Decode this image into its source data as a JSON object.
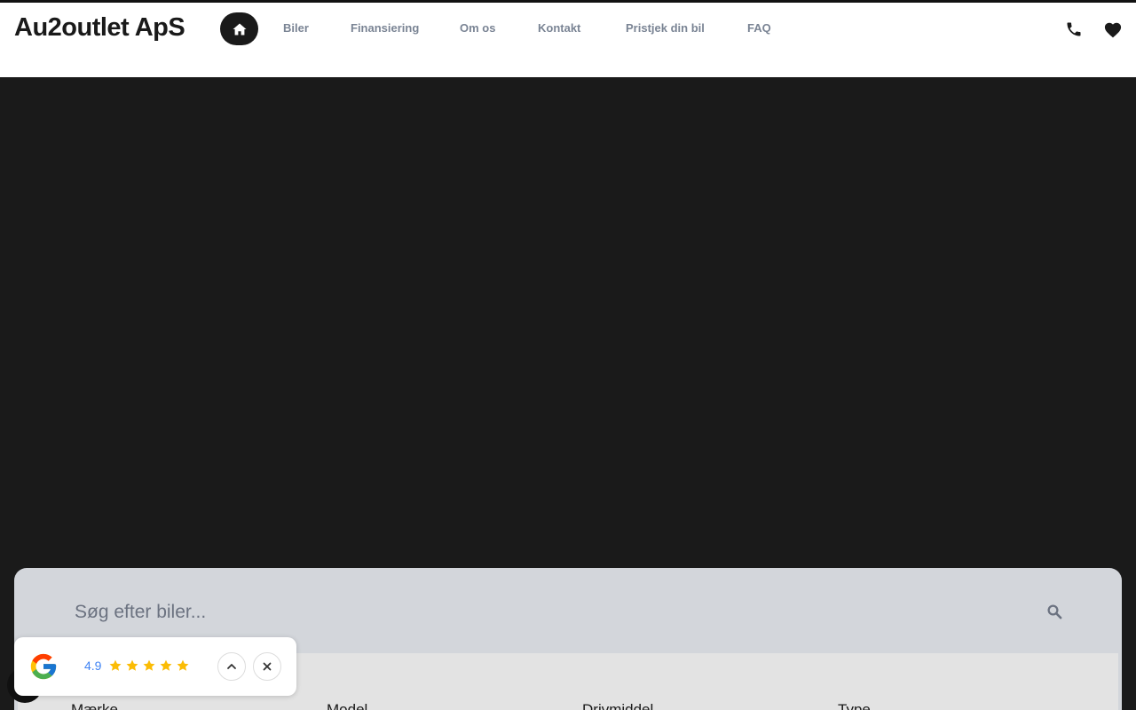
{
  "header": {
    "logo": "Au2outlet ApS",
    "home_icon": "home-icon",
    "nav": [
      {
        "label": "Biler"
      },
      {
        "label": "Finansiering"
      },
      {
        "label": "Om os"
      },
      {
        "label": "Kontakt"
      },
      {
        "label": "Pristjek din bil"
      },
      {
        "label": "FAQ"
      }
    ],
    "icons": [
      "phone-icon",
      "heart-icon"
    ]
  },
  "search": {
    "placeholder": "Søg efter biler...",
    "icon": "search-icon",
    "filters": [
      {
        "label": "Mærke"
      },
      {
        "label": "Model"
      },
      {
        "label": "Drivmiddel"
      },
      {
        "label": "Type"
      }
    ]
  },
  "google_widget": {
    "rating": "4.9",
    "stars": 5,
    "icons": [
      "google-logo-icon",
      "star-icon",
      "chevron-up-icon",
      "close-icon"
    ]
  },
  "colors": {
    "dark": "#1a1a1a",
    "nav_text": "#7a8494",
    "search_bg": "#d3d6db",
    "filter_bg": "#e3e3e3",
    "star": "#fbbc04",
    "rating_text": "#4285f4"
  }
}
